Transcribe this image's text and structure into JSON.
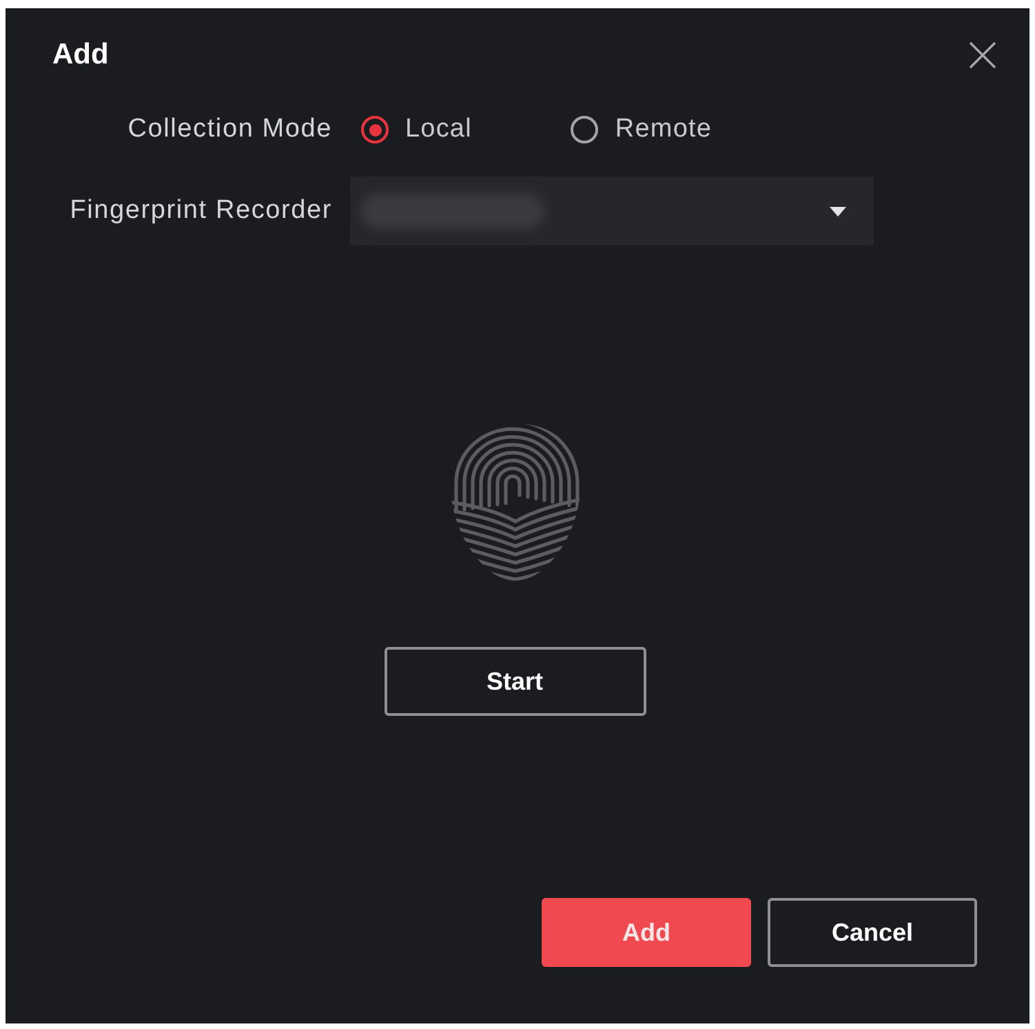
{
  "dialog": {
    "title": "Add"
  },
  "fields": [
    {
      "kind": "radio",
      "label": "Collection Mode",
      "options": [
        {
          "label": "Local",
          "selected": true
        },
        {
          "label": "Remote",
          "selected": false
        }
      ]
    },
    {
      "kind": "dropdown",
      "label": "Fingerprint Recorder",
      "value_blurred": true
    }
  ],
  "capture": {
    "button": "Start"
  },
  "buttons": [
    {
      "kind": "primary",
      "label": "Add"
    },
    {
      "kind": "secondary",
      "label": "Cancel"
    }
  ]
}
